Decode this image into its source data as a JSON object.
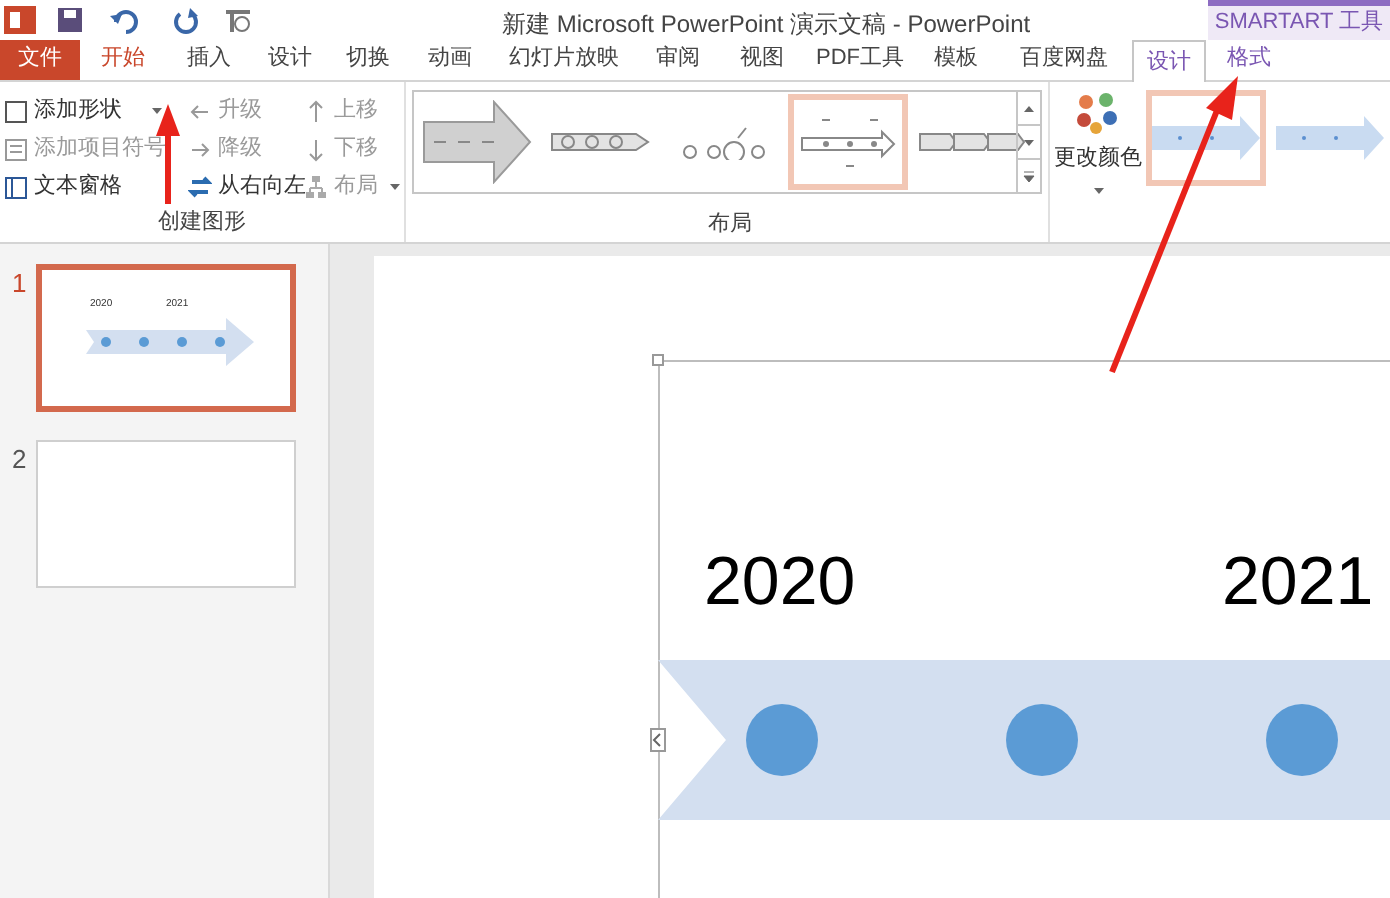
{
  "title_bar": {
    "title": "新建 Microsoft PowerPoint 演示文稿 - PowerPoint",
    "contextual_label": "SMARTART 工具"
  },
  "tabs": [
    {
      "label": "文件",
      "kind": "file",
      "selected": false
    },
    {
      "label": "开始",
      "kind": "normal",
      "selected": false
    },
    {
      "label": "插入",
      "kind": "normal",
      "selected": false
    },
    {
      "label": "设计",
      "kind": "normal",
      "selected": false
    },
    {
      "label": "切换",
      "kind": "normal",
      "selected": false
    },
    {
      "label": "动画",
      "kind": "normal",
      "selected": false
    },
    {
      "label": "幻灯片放映",
      "kind": "normal",
      "selected": false
    },
    {
      "label": "审阅",
      "kind": "normal",
      "selected": false
    },
    {
      "label": "视图",
      "kind": "normal",
      "selected": false
    },
    {
      "label": "PDF工具",
      "kind": "normal",
      "selected": false
    },
    {
      "label": "模板",
      "kind": "normal",
      "selected": false
    },
    {
      "label": "百度网盘",
      "kind": "normal",
      "selected": false
    },
    {
      "label": "设计",
      "kind": "contextual",
      "selected": true
    },
    {
      "label": "格式",
      "kind": "contextual",
      "selected": false
    }
  ],
  "create_group": {
    "label": "创建图形",
    "columns": [
      [
        {
          "label": "添加形状",
          "dropdown": true,
          "disabled": false
        },
        {
          "label": "添加项目符号",
          "dropdown": false,
          "disabled": true
        },
        {
          "label": "文本窗格",
          "dropdown": false,
          "disabled": false
        }
      ],
      [
        {
          "label": "升级",
          "dropdown": false,
          "disabled": true
        },
        {
          "label": "降级",
          "dropdown": false,
          "disabled": true
        },
        {
          "label": "从右向左",
          "dropdown": false,
          "disabled": false
        }
      ],
      [
        {
          "label": "上移",
          "dropdown": false,
          "disabled": true
        },
        {
          "label": "下移",
          "dropdown": false,
          "disabled": true
        },
        {
          "label": "布局",
          "dropdown": true,
          "disabled": true
        }
      ]
    ]
  },
  "layout_group": {
    "label": "布局",
    "layouts": [
      {
        "selected": false
      },
      {
        "selected": false
      },
      {
        "selected": false
      },
      {
        "selected": true
      },
      {
        "selected": false
      }
    ]
  },
  "color_button": {
    "label": "更改颜色"
  },
  "styles": [
    {
      "selected": true
    },
    {
      "selected": false
    }
  ],
  "slides": [
    {
      "number": "1",
      "selected": true,
      "labels": [
        "2020",
        "2021"
      ]
    },
    {
      "number": "2",
      "selected": false
    }
  ],
  "slide_canvas": {
    "labels": [
      "2020",
      "2021"
    ]
  }
}
